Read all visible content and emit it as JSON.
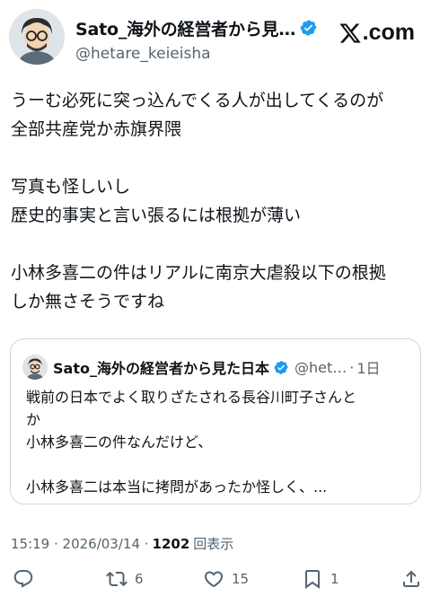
{
  "author": {
    "display_name": "Sato_海外の経営者から見…",
    "handle": "@hetare_keieisha"
  },
  "brand": {
    "text": ".com"
  },
  "tweet": {
    "paragraphs": [
      [
        "うーむ必死に突っ込んでくる人が出してくるのが",
        "全部共産党か赤旗界隈"
      ],
      [
        "写真も怪しいし",
        "歴史的事実と言い張るには根拠が薄い"
      ],
      [
        "小林多喜二の件はリアルに南京大虐殺以下の根拠",
        "しか無さそうですね"
      ]
    ]
  },
  "quote": {
    "display_name": "Sato_海外の経営者から見た日本",
    "handle": "@het…",
    "dot": "·",
    "date": "1日",
    "lines": [
      "戦前の日本でよく取りざたされる長谷川町子さんと",
      "か",
      "小林多喜二の件なんだけど、"
    ],
    "lines2": [
      "小林多喜二は本当に拷問があったか怪しく、..."
    ]
  },
  "meta": {
    "time": "15:19 · 2026/03/14 ·",
    "views_count": "1202",
    "views_label": "回表示"
  },
  "actions": {
    "reply_count": "",
    "retweet_count": "6",
    "like_count": "15",
    "bookmark_count": "1"
  },
  "colors": {
    "verified": "#1d9bf0",
    "secondary": "#536471",
    "text": "#0f1419"
  }
}
